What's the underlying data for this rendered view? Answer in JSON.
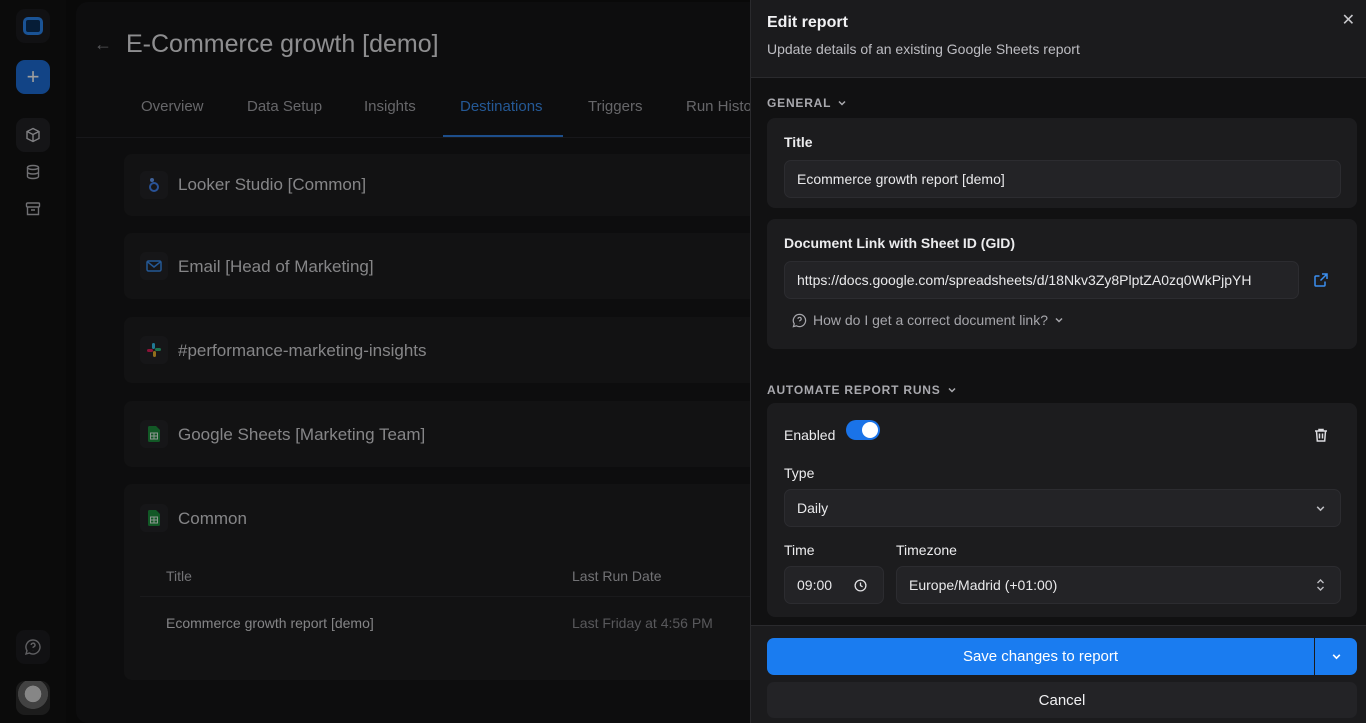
{
  "page": {
    "title": "E-Commerce growth [demo]",
    "tabs": [
      {
        "label": "Overview"
      },
      {
        "label": "Data Setup"
      },
      {
        "label": "Insights"
      },
      {
        "label": "Destinations"
      },
      {
        "label": "Triggers"
      },
      {
        "label": "Run Histo"
      }
    ],
    "active_tab": "Destinations",
    "destinations": [
      {
        "name": "Looker Studio [Common]",
        "icon": "looker-studio-icon"
      },
      {
        "name": "Email [Head of Marketing]",
        "icon": "mail-icon"
      },
      {
        "name": "#performance-marketing-insights",
        "icon": "slack-icon"
      },
      {
        "name": "Google Sheets [Marketing Team]",
        "icon": "google-sheets-icon"
      }
    ],
    "common": {
      "name": "Common",
      "col_title": "Title",
      "col_last_run": "Last Run Date",
      "row_title": "Ecommerce growth report [demo]",
      "row_last_run": "Last Friday at 4:56 PM"
    }
  },
  "panel": {
    "title": "Edit report",
    "subtitle": "Update details of an existing Google Sheets report",
    "general_label": "GENERAL",
    "title_label": "Title",
    "title_value": "Ecommerce growth report [demo]",
    "doc_label": "Document Link with Sheet ID (GID)",
    "doc_value": "https://docs.google.com/spreadsheets/d/18Nkv3Zy8PlptZA0zq0WkPjpYH",
    "doc_hint": "How do I get a correct document link?",
    "automate_label": "AUTOMATE REPORT RUNS",
    "enabled_label": "Enabled",
    "enabled": true,
    "type_label": "Type",
    "type_value": "Daily",
    "time_label": "Time",
    "time_value": "09:00",
    "timezone_label": "Timezone",
    "timezone_value": "Europe/Madrid (+01:00)",
    "save_label": "Save changes to report",
    "cancel_label": "Cancel"
  },
  "colors": {
    "accent": "#1a7cf0",
    "toggle": "#1a73e8"
  }
}
